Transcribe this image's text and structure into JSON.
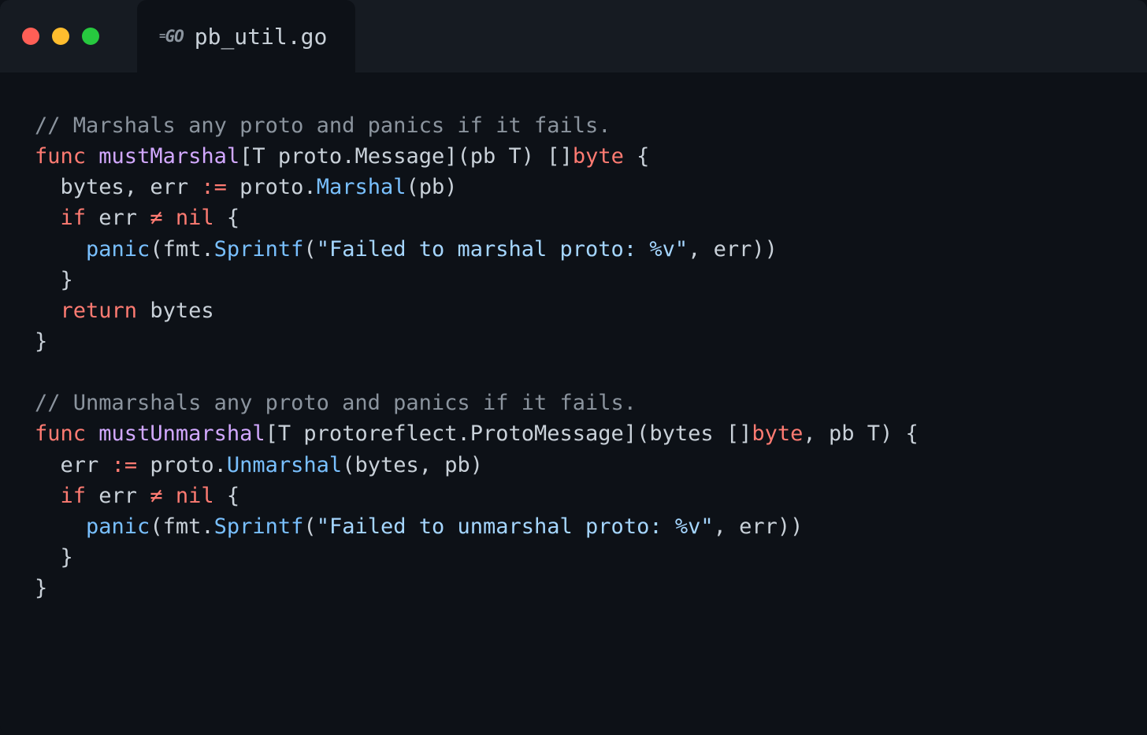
{
  "tab": {
    "filename": "pb_util.go",
    "language": "GO"
  },
  "code": {
    "lines": [
      {
        "type": "comment",
        "text": "// Marshals any proto and panics if it fails."
      },
      {
        "type": "func1_sig"
      },
      {
        "type": "func1_body1"
      },
      {
        "type": "func1_if"
      },
      {
        "type": "func1_panic"
      },
      {
        "type": "close_brace2"
      },
      {
        "type": "func1_return"
      },
      {
        "type": "close_brace1"
      },
      {
        "type": "blank"
      },
      {
        "type": "comment",
        "text": "// Unmarshals any proto and panics if it fails."
      },
      {
        "type": "func2_sig"
      },
      {
        "type": "func2_body1"
      },
      {
        "type": "func2_if"
      },
      {
        "type": "func2_panic"
      },
      {
        "type": "close_brace2"
      },
      {
        "type": "close_brace1"
      }
    ],
    "tokens": {
      "func": "func",
      "mustMarshal": "mustMarshal",
      "mustUnmarshal": "mustUnmarshal",
      "proto_Message": "proto.Message",
      "protoreflect_ProtoMessage": "protoreflect.ProtoMessage",
      "pb": "pb",
      "T": "T",
      "byte": "byte",
      "bytes": "bytes",
      "err": "err",
      "proto": "proto",
      "Marshal": "Marshal",
      "Unmarshal": "Unmarshal",
      "if": "if",
      "neq": "≠",
      "nil": "nil",
      "panic": "panic",
      "fmt": "fmt",
      "Sprintf": "Sprintf",
      "str_marshal": "\"Failed to marshal proto: %v\"",
      "str_unmarshal": "\"Failed to unmarshal proto: %v\"",
      "return": "return",
      "assign": ":="
    }
  }
}
